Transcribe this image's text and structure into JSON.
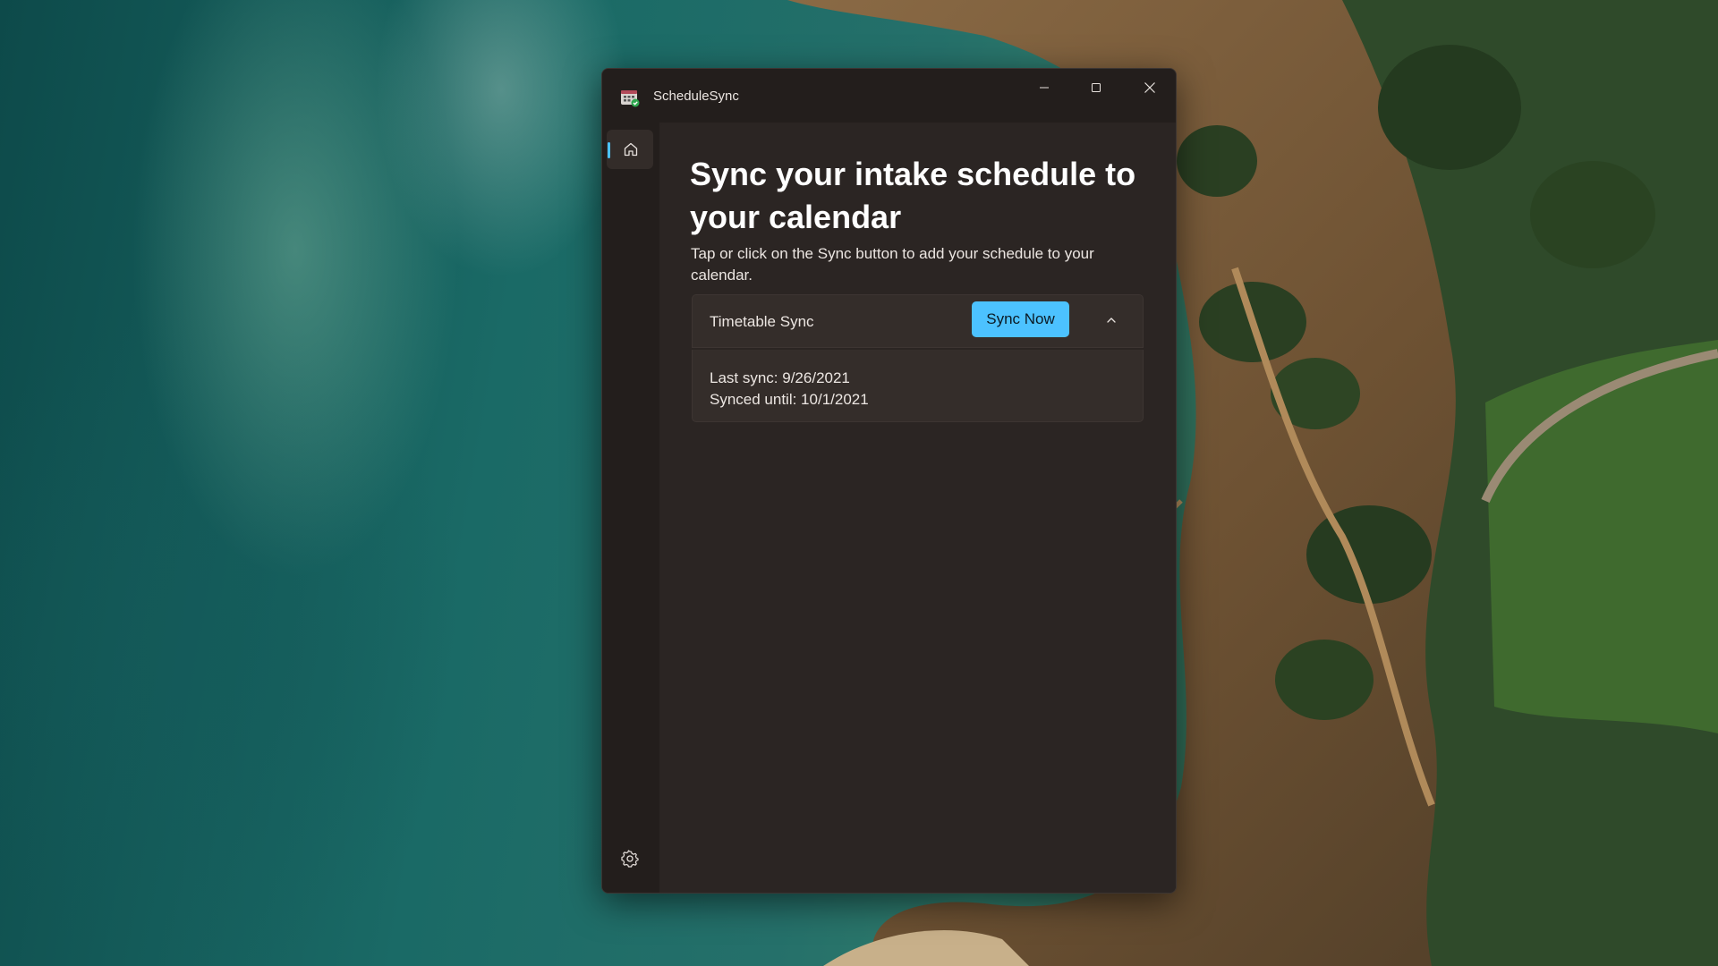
{
  "window": {
    "app_title": "ScheduleSync",
    "controls": {
      "minimize_icon": "minimize-icon",
      "maximize_icon": "maximize-icon",
      "close_icon": "close-icon"
    }
  },
  "nav": {
    "items": [
      {
        "icon": "home-icon",
        "selected": true
      },
      {
        "icon": "gear-icon",
        "selected": false
      }
    ]
  },
  "main": {
    "heading": "Sync your intake schedule to your calendar",
    "subtitle": "Tap or click on the Sync button to add your schedule to your calendar.",
    "card": {
      "title": "Timetable Sync",
      "button_label": "Sync Now",
      "expanded": true,
      "expander_icon": "chevron-up-icon",
      "details": [
        "Last sync: 9/26/2021",
        "Synced until: 10/1/2021"
      ]
    }
  },
  "colors": {
    "accent": "#4cc2ff",
    "window_bg": "#2b2523",
    "card_bg": "#342d2a",
    "nav_bg": "#231e1c"
  }
}
